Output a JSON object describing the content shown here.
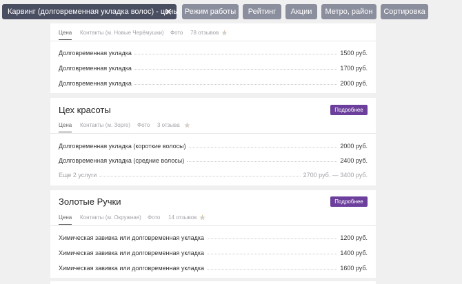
{
  "filters": {
    "active": "Карвинг (долговременная укладка волос) - цены",
    "close_glyph": "✕",
    "chips": [
      "Режим работы",
      "Рейтинг",
      "Акции",
      "Метро, район",
      "Сортировка"
    ]
  },
  "cards": [
    {
      "name": "",
      "button": "",
      "tabs": {
        "price": "Цена",
        "contacts": "Контакты (м. Новые Черёмушки)",
        "photo": "Фото",
        "reviews": "78 отзывов"
      },
      "rating": 4,
      "services": [
        {
          "name": "Долговременная укладка",
          "price": "1500 руб."
        },
        {
          "name": "Долговременная укладка",
          "price": "1700 руб."
        },
        {
          "name": "Долговременная укладка",
          "price": "2000 руб."
        }
      ]
    },
    {
      "name": "Цех красоты",
      "button": "Подробнее",
      "tabs": {
        "price": "Цена",
        "contacts": "Контакты (м. Зорге)",
        "photo": "Фото",
        "reviews": "3 отзыва"
      },
      "rating": 3,
      "services": [
        {
          "name": "Долговременная укладка (короткие волосы)",
          "price": "2000 руб."
        },
        {
          "name": "Долговременная укладка (средние волосы)",
          "price": "2400 руб."
        }
      ],
      "more_services": {
        "label": "Еще 2 услуги",
        "price": "2700 руб. — 3400 руб."
      }
    },
    {
      "name": "Золотые Ручки",
      "button": "Подробнее",
      "tabs": {
        "price": "Цена",
        "contacts": "Контакты (м. Окружная)",
        "photo": "Фото",
        "reviews": "14 отзывов"
      },
      "rating": 4,
      "services": [
        {
          "name": "Химическая завивка или долговременная укладка",
          "price": "1200 руб."
        },
        {
          "name": "Химическая завивка или долговременная укладка",
          "price": "1400 руб."
        },
        {
          "name": "Химическая завивка или долговременная укладка",
          "price": "1600 руб."
        }
      ]
    }
  ],
  "colors": {
    "accent_button": "#6c3f9d",
    "active_chip": "#4a4e61",
    "filter_chip": "#8b8e9d",
    "star": "#f2b01e"
  }
}
